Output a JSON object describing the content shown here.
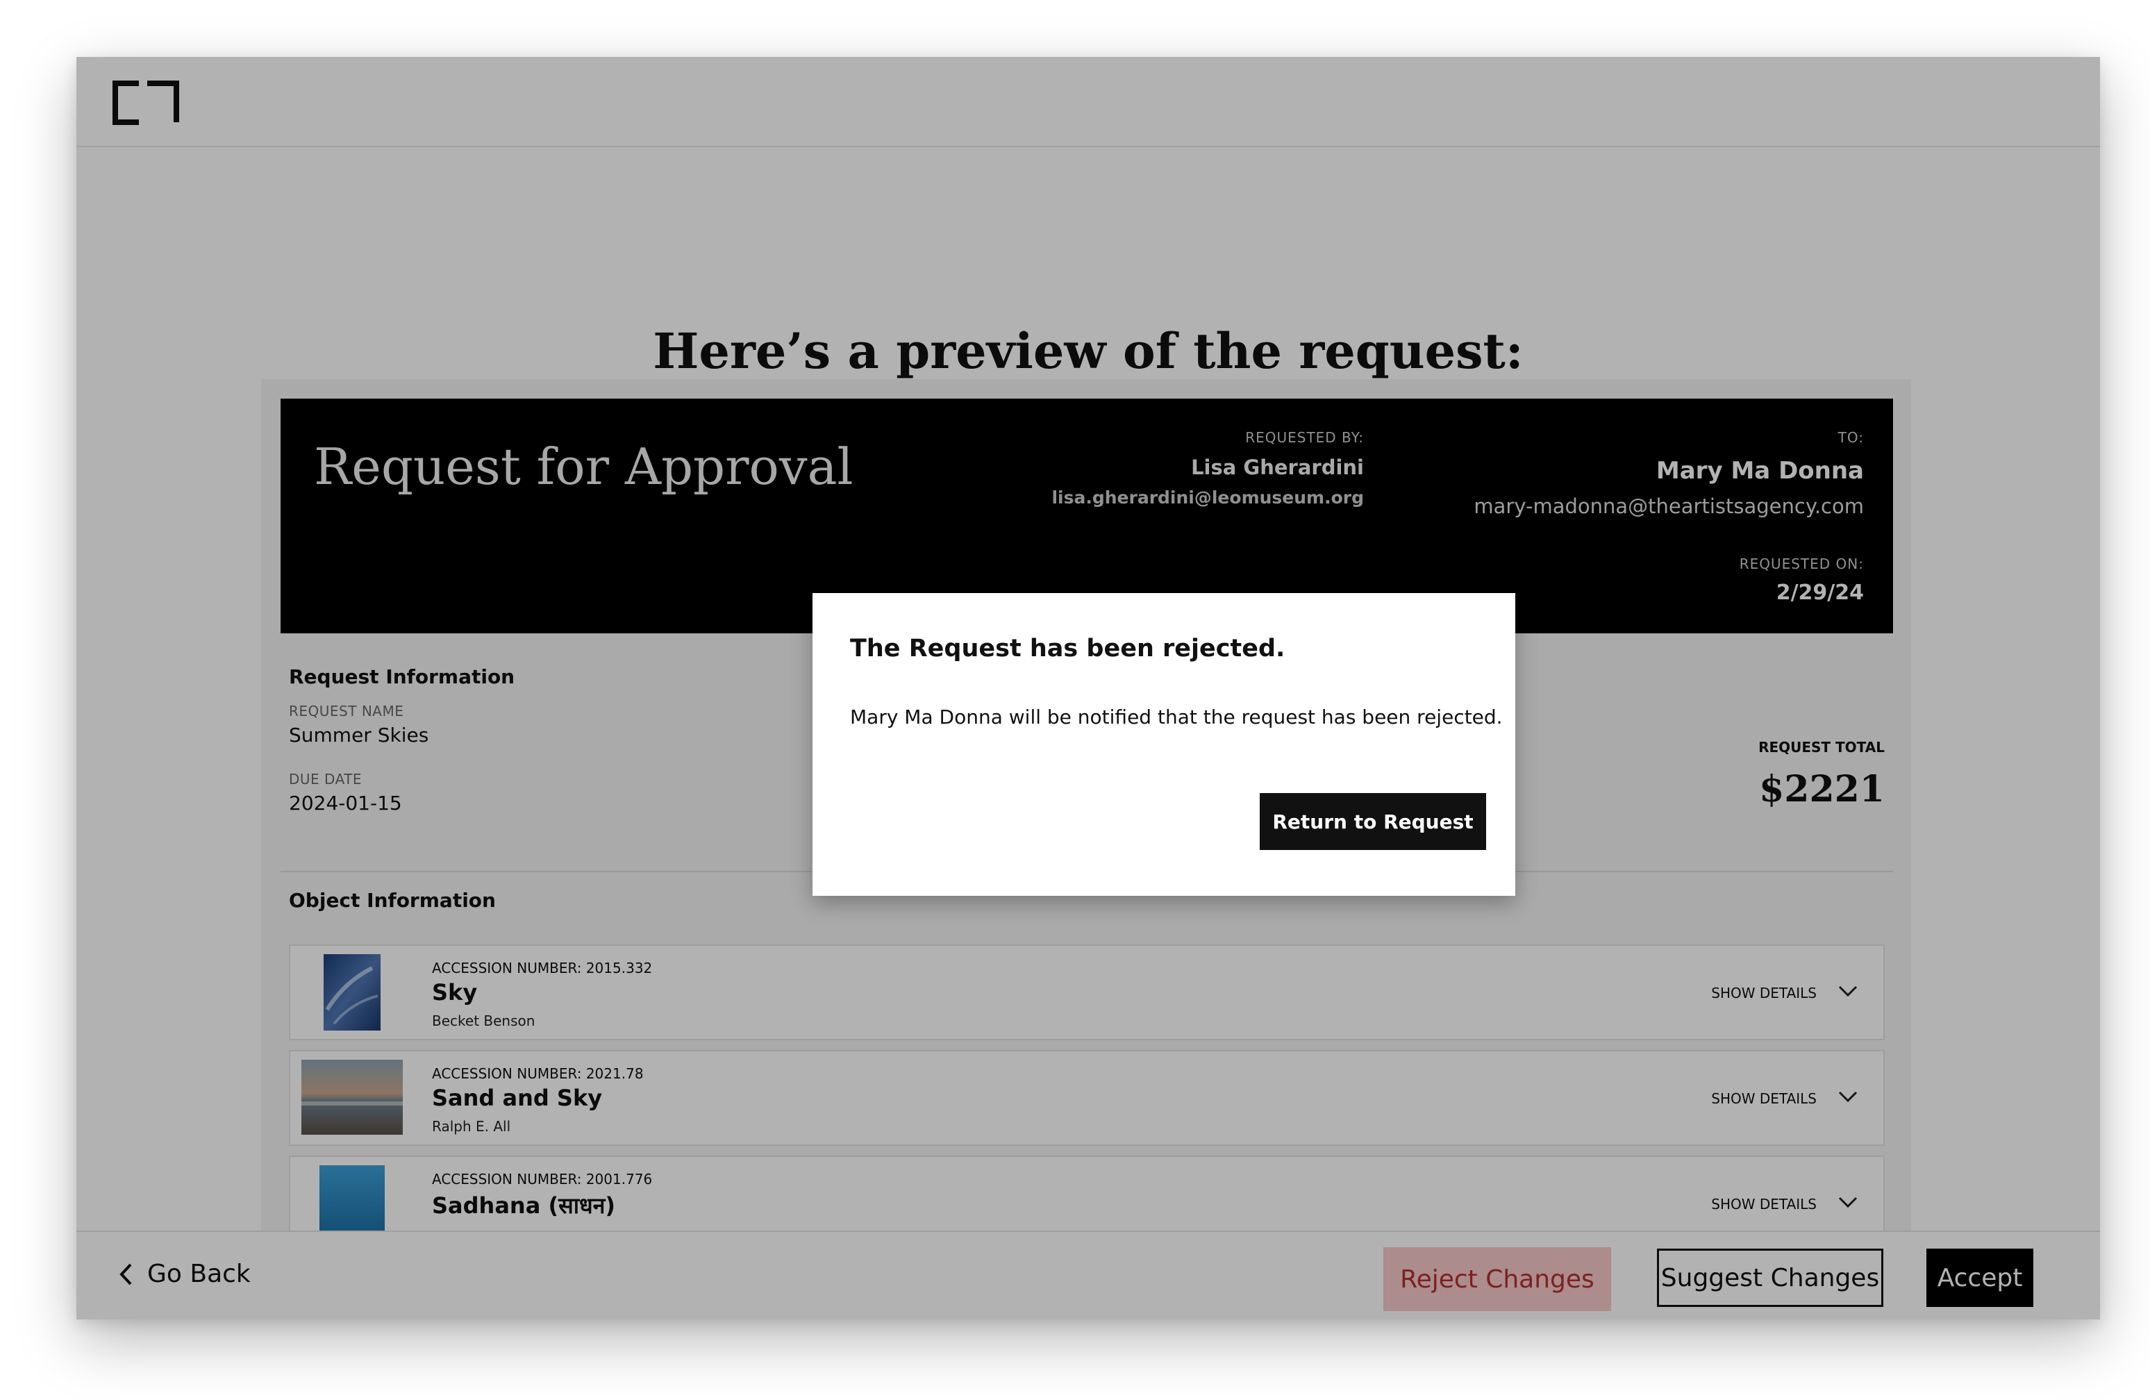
{
  "page": {
    "title": "Here’s a preview of the request:"
  },
  "request_header": {
    "title": "Request for Approval",
    "requested_by_label": "REQUESTED BY:",
    "requested_by_name": "Lisa Gherardini",
    "requested_by_email": "lisa.gherardini@leomuseum.org",
    "to_label": "TO:",
    "to_name": "Mary Ma Donna",
    "to_email": "mary-madonna@theartistsagency.com",
    "requested_on_label": "REQUESTED ON:",
    "requested_on": "2/29/24"
  },
  "request_info": {
    "section_title": "Request Information",
    "name_label": "REQUEST NAME",
    "name": "Summer Skies",
    "due_label": "DUE DATE",
    "due": "2024-01-15",
    "total_label": "REQUEST TOTAL",
    "total": "$2221"
  },
  "object_info": {
    "section_title": "Object Information",
    "items": [
      {
        "accession": "ACCESSION NUMBER: 2015.332",
        "title": "Sky",
        "artist": "Becket Benson",
        "show_details": "SHOW DETAILS"
      },
      {
        "accession": "ACCESSION NUMBER: 2021.78",
        "title": "Sand and Sky",
        "artist": "Ralph E. All",
        "show_details": "SHOW DETAILS"
      },
      {
        "accession": "ACCESSION NUMBER: 2001.776",
        "title": "Sadhana (साधन)",
        "artist": "",
        "show_details": "SHOW DETAILS"
      }
    ]
  },
  "footer": {
    "go_back": "Go Back",
    "reject": "Reject Changes",
    "suggest": "Suggest Changes",
    "accept": "Accept"
  },
  "modal": {
    "title": "The Request has been rejected.",
    "body": "Mary Ma Donna will be notified that the request has been rejected.",
    "button": "Return to Request"
  },
  "colors": {
    "reject_bg": "#f6c9c9",
    "reject_text": "#b42e2e",
    "header_bg": "#000000"
  }
}
